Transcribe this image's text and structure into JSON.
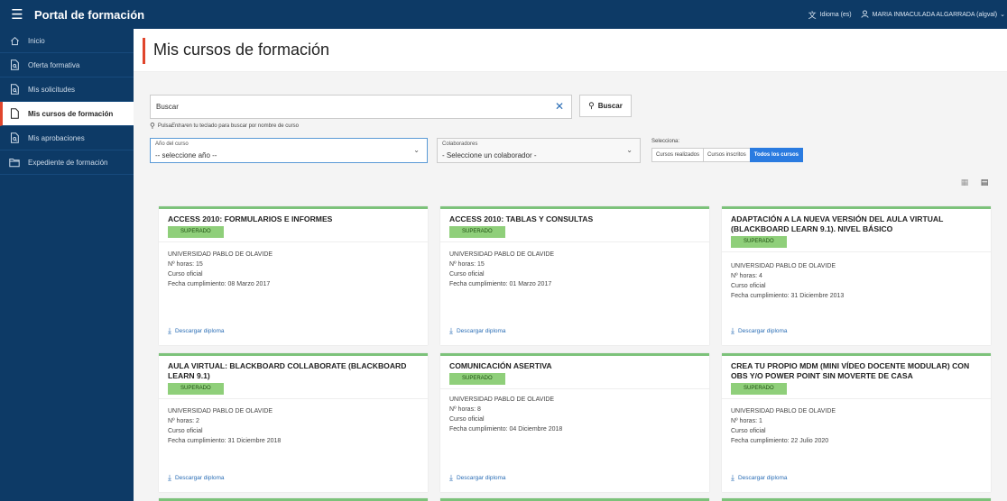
{
  "app": {
    "title": "Portal de formación"
  },
  "topbar": {
    "language": "Idioma (es)",
    "user": "MARIA INMACULADA ALGARRADA (algval)"
  },
  "sidebar": {
    "items": [
      {
        "label": "Inicio",
        "icon": "home-icon"
      },
      {
        "label": "Oferta formativa",
        "icon": "document-search-icon"
      },
      {
        "label": "Mis solicitudes",
        "icon": "document-search-icon"
      },
      {
        "label": "Mis cursos de formación",
        "icon": "document-icon",
        "active": true
      },
      {
        "label": "Mis aprobaciones",
        "icon": "document-search-icon"
      },
      {
        "label": "Expediente de formación",
        "icon": "folder-icon"
      }
    ]
  },
  "page": {
    "title": "Mis cursos de formación"
  },
  "search": {
    "value": "Buscar",
    "button": "Buscar",
    "hint_prefix": "Pulsa ",
    "hint_key": "Entrar",
    "hint_suffix": " en tu teclado para buscar por nombre de curso"
  },
  "filters": {
    "year": {
      "label": "Año del curso",
      "value": "-- seleccione año --"
    },
    "collab": {
      "label": "Colaboradores",
      "value": "- Seleccione un colaborador -"
    },
    "segment_label": "Selecciona:",
    "segments": [
      "Cursos realizados",
      "Cursos inscritos",
      "Todos los cursos"
    ],
    "selected_segment": "Todos los cursos"
  },
  "colors": {
    "brand": "#0d3a66",
    "accent": "#e0452c",
    "success": "#8fcf7a",
    "primary": "#2a7be0"
  },
  "courses": [
    {
      "title": "ACCESS 2010: FORMULARIOS E INFORMES",
      "status": "SUPERADO",
      "university": "UNIVERSIDAD PABLO DE OLAVIDE",
      "hours": "Nº horas: 15",
      "type": "Curso oficial",
      "date": "Fecha cumplimiento: 08 Marzo 2017",
      "download": "Descargar diploma"
    },
    {
      "title": "ACCESS 2010: TABLAS Y CONSULTAS",
      "status": "SUPERADO",
      "university": "UNIVERSIDAD PABLO DE OLAVIDE",
      "hours": "Nº horas: 15",
      "type": "Curso oficial",
      "date": "Fecha cumplimiento: 01 Marzo 2017",
      "download": "Descargar diploma"
    },
    {
      "title": "ADAPTACIÓN A LA NUEVA VERSIÓN DEL AULA VIRTUAL (BLACKBOARD LEARN 9.1). NIVEL BÁSICO",
      "status": "SUPERADO",
      "university": "UNIVERSIDAD PABLO DE OLAVIDE",
      "hours": "Nº horas: 4",
      "type": "Curso oficial",
      "date": "Fecha cumplimiento: 31 Diciembre 2013",
      "download": "Descargar diploma"
    },
    {
      "title": "AULA VIRTUAL: BLACKBOARD COLLABORATE (BLACKBOARD LEARN 9.1)",
      "status": "SUPERADO",
      "university": "UNIVERSIDAD PABLO DE OLAVIDE",
      "hours": "Nº horas: 2",
      "type": "Curso oficial",
      "date": "Fecha cumplimiento: 31 Diciembre 2018",
      "download": "Descargar diploma"
    },
    {
      "title": "COMUNICACIÓN ASERTIVA",
      "status": "SUPERADO",
      "university": "UNIVERSIDAD PABLO DE OLAVIDE",
      "hours": "Nº horas: 8",
      "type": "Curso oficial",
      "date": "Fecha cumplimiento: 04 Diciembre 2018",
      "download": "Descargar diploma"
    },
    {
      "title": "CREA TU PROPIO MDM (MINI VÍDEO DOCENTE MODULAR) CON OBS Y/O POWER POINT SIN MOVERTE DE CASA",
      "status": "SUPERADO",
      "university": "UNIVERSIDAD PABLO DE OLAVIDE",
      "hours": "Nº horas: 1",
      "type": "Curso oficial",
      "date": "Fecha cumplimiento: 22 Julio 2020",
      "download": "Descargar diploma"
    }
  ]
}
